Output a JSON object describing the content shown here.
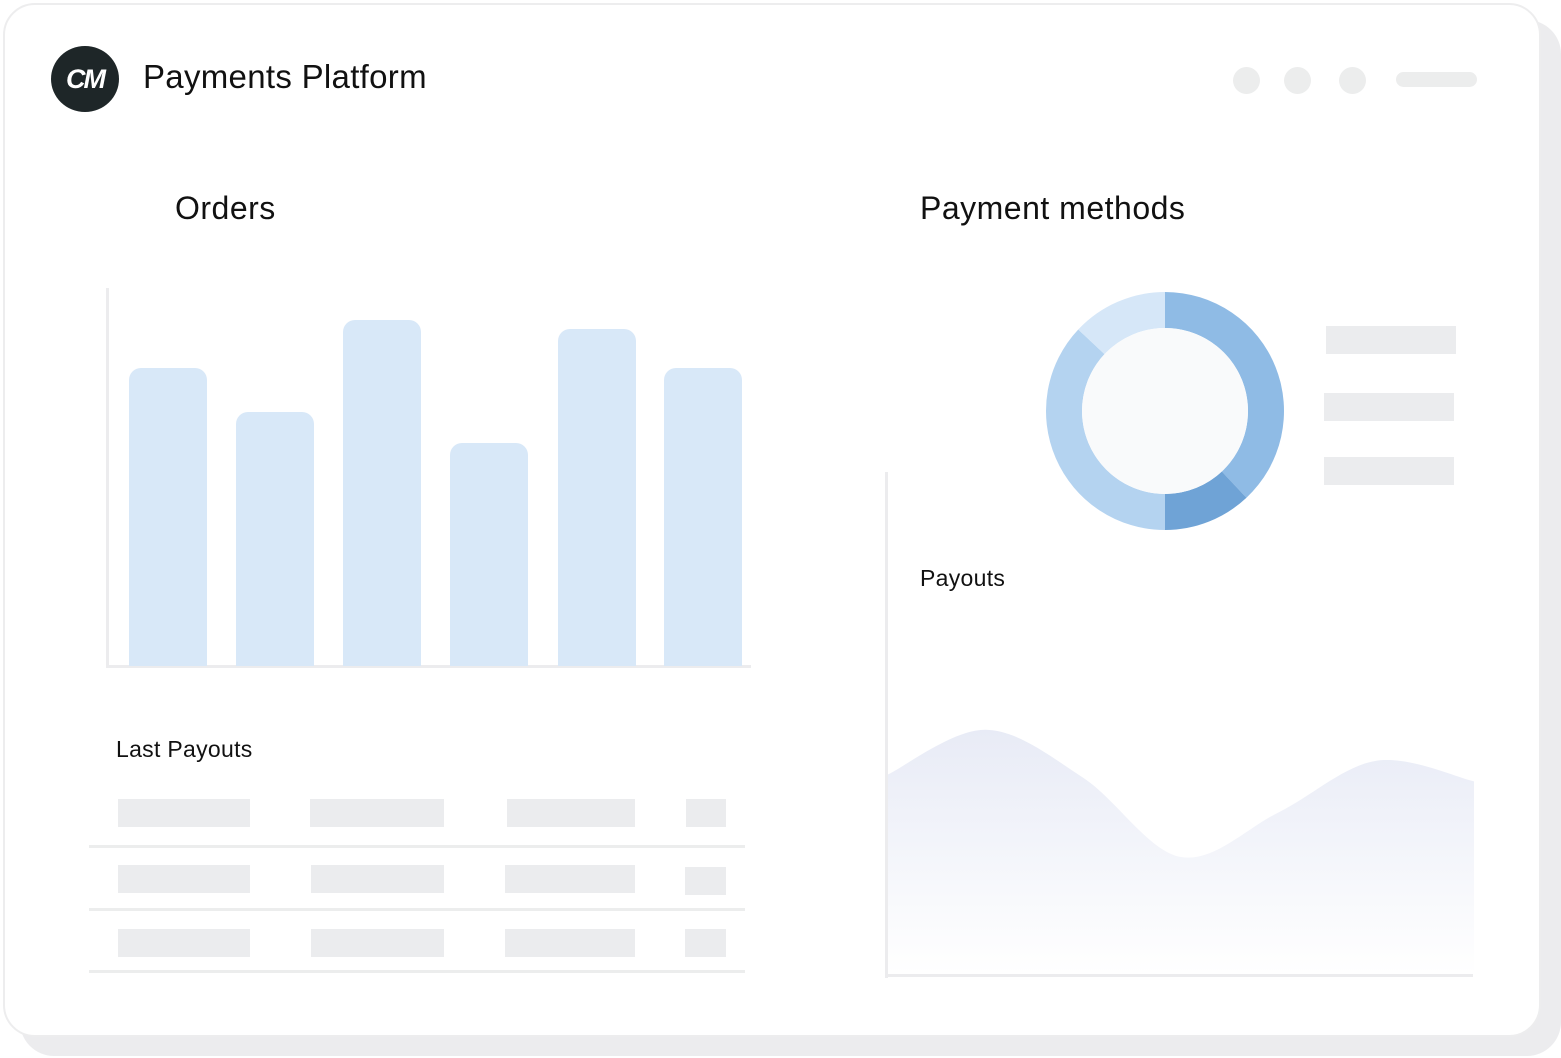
{
  "app": {
    "title": "Payments Platform",
    "logo_text": "CM",
    "logo_icon": "cm-logo-icon"
  },
  "window_controls": {
    "dots": 3
  },
  "orders": {
    "title": "Orders"
  },
  "payment_methods": {
    "title": "Payment methods"
  },
  "payouts": {
    "title": "Payouts"
  },
  "last_payouts": {
    "title": "Last Payouts",
    "rows": 3,
    "columns": 4
  },
  "colors": {
    "bar_fill": "#d8e8f8",
    "donut_segments": [
      "#8fbbe5",
      "#6fa3d6",
      "#b4d3f0",
      "#d6e7f8"
    ],
    "placeholder": "#ebecee",
    "logo_bg": "#1e2628"
  },
  "chart_data": [
    {
      "type": "bar",
      "categories": [
        "",
        "",
        "",
        "",
        "",
        ""
      ],
      "values": [
        68,
        58,
        79,
        51,
        77,
        68
      ],
      "ylim": [
        0,
        100
      ],
      "grid": false
    },
    {
      "type": "pie",
      "values": [
        38,
        12,
        37,
        13
      ],
      "donut": true
    },
    {
      "type": "area",
      "x": [
        0,
        1,
        2,
        3,
        4,
        5,
        6
      ],
      "values": [
        58,
        71,
        57,
        34,
        47,
        62,
        56
      ],
      "ylim": [
        0,
        100
      ],
      "grid": false
    }
  ]
}
